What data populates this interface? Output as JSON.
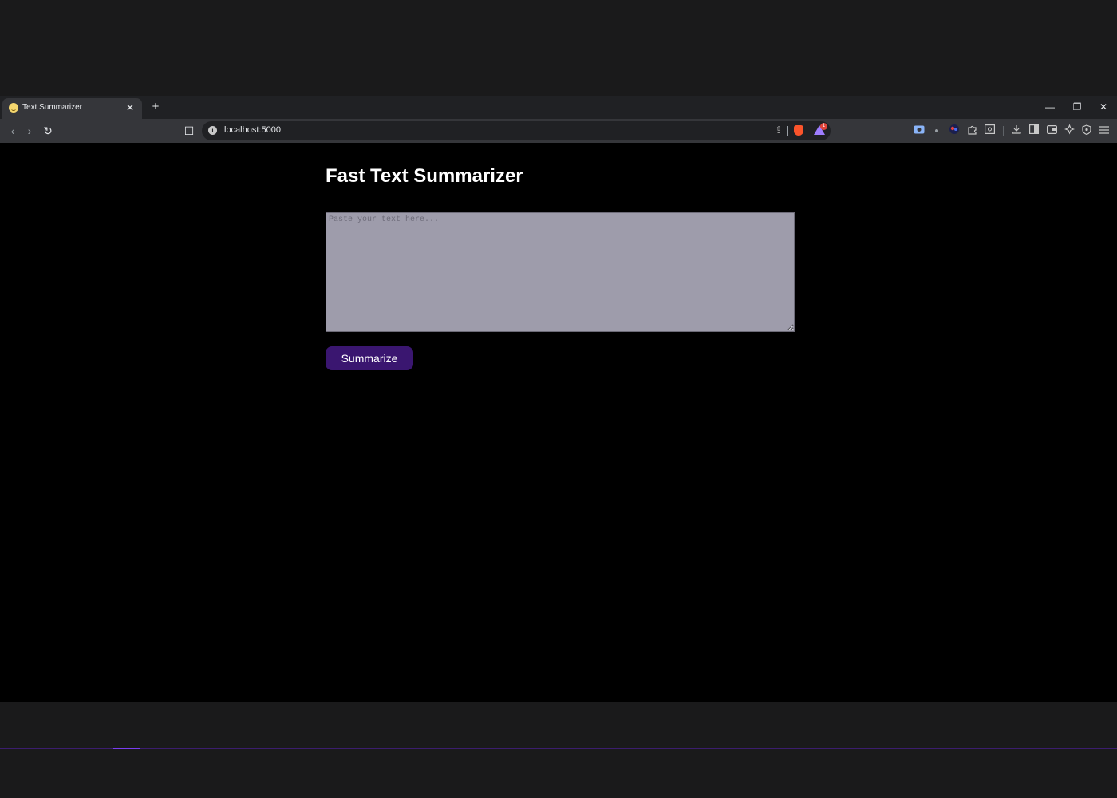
{
  "tab": {
    "title": "Text Summarizer",
    "close": "✕"
  },
  "new_tab": "+",
  "window_controls": {
    "minimize": "—",
    "restore": "❐",
    "close": "✕"
  },
  "toolbar": {
    "back": "‹",
    "forward": "›",
    "reload": "↻",
    "bookmark": "☐",
    "info": "i",
    "share": "⇪"
  },
  "address": {
    "url": "localhost:5000"
  },
  "rewards_badge": "1",
  "page": {
    "title": "Fast Text Summarizer",
    "textarea_placeholder": "Paste your text here...",
    "button_label": "Summarize"
  },
  "colors": {
    "button": "#3a1670",
    "textarea": "#9e9cab",
    "background": "#000000"
  },
  "icons": [
    "back-icon",
    "forward-icon",
    "reload-icon",
    "bookmark-icon",
    "share-icon",
    "brave-shields-icon",
    "brave-rewards-icon",
    "download-icon",
    "sidebar-icon",
    "wallet-icon",
    "leo-icon",
    "vpn-icon",
    "menu-icon"
  ]
}
